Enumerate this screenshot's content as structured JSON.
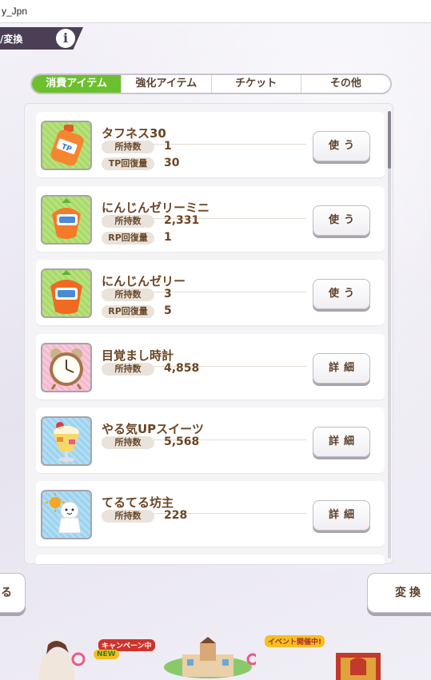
{
  "window": {
    "title": "y_Jpn"
  },
  "header": {
    "title": "/変換",
    "info_label": "i"
  },
  "tabs": [
    {
      "label": "消費アイテム",
      "active": true
    },
    {
      "label": "強化アイテム",
      "active": false
    },
    {
      "label": "チケット",
      "active": false
    },
    {
      "label": "その他",
      "active": false
    }
  ],
  "items": [
    {
      "name": "タフネス30",
      "icon": "tp-bottle-icon",
      "stats": [
        {
          "label": "所持数",
          "value": "1"
        },
        {
          "label": "TP回復量",
          "value": "30"
        }
      ],
      "action": "使う"
    },
    {
      "name": "にんじんゼリーミニ",
      "icon": "carrot-jelly-mini-icon",
      "stats": [
        {
          "label": "所持数",
          "value": "2,331"
        },
        {
          "label": "RP回復量",
          "value": "1"
        }
      ],
      "action": "使う"
    },
    {
      "name": "にんじんゼリー",
      "icon": "carrot-jelly-icon",
      "stats": [
        {
          "label": "所持数",
          "value": "3"
        },
        {
          "label": "RP回復量",
          "value": "5"
        }
      ],
      "action": "使う"
    },
    {
      "name": "目覚まし時計",
      "icon": "alarm-clock-icon",
      "stats": [
        {
          "label": "所持数",
          "value": "4,858"
        }
      ],
      "action": "詳細"
    },
    {
      "name": "やる気UPスイーツ",
      "icon": "parfait-icon",
      "stats": [
        {
          "label": "所持数",
          "value": "5,568"
        }
      ],
      "action": "詳細"
    },
    {
      "name": "てるてる坊主",
      "icon": "teru-teru-bozu-icon",
      "stats": [
        {
          "label": "所持数",
          "value": "228"
        }
      ],
      "action": "詳細"
    }
  ],
  "footer": {
    "back_label": "る",
    "convert_label": "変換"
  },
  "bottom_nav": {
    "campaign_badge": "キャンペーン中",
    "new_badge": "NEW",
    "event_badge": "イベント開催中!"
  },
  "colors": {
    "tab_active": "#6cc02e",
    "text_brown": "#6b4524",
    "header_dark": "#4a3f55"
  }
}
